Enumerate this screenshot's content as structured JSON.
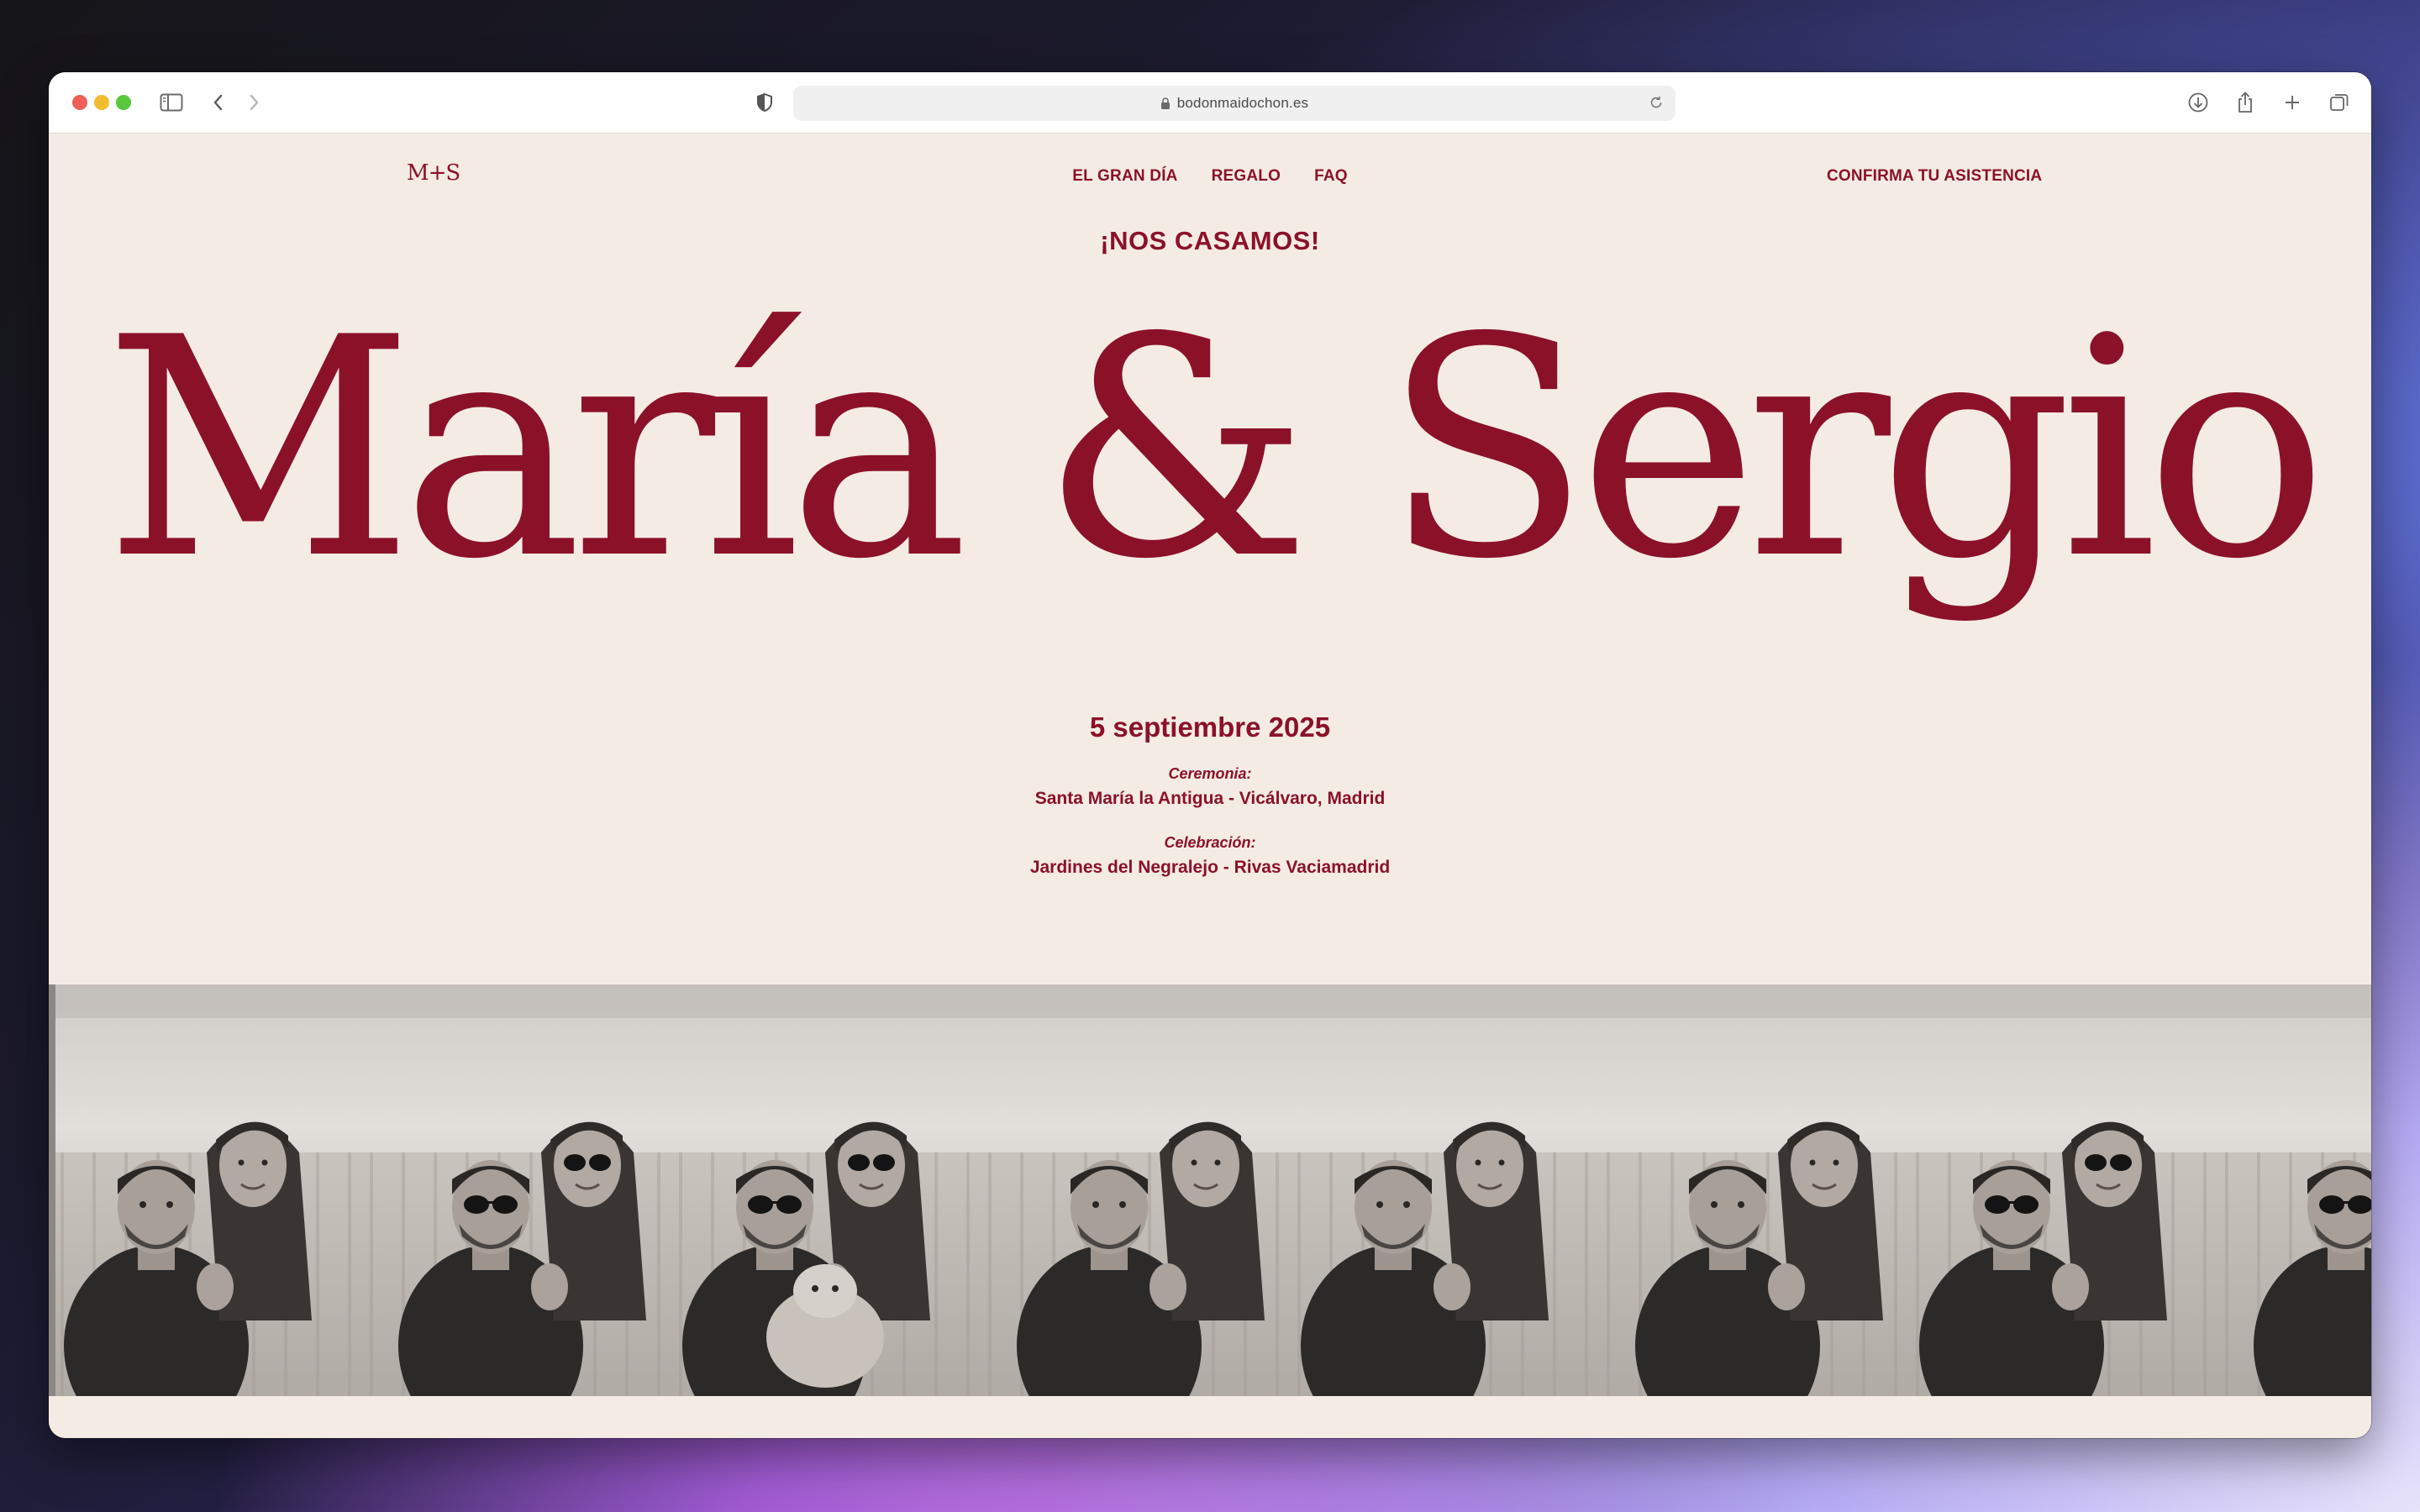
{
  "browser": {
    "url": "bodonmaidochon.es"
  },
  "site": {
    "logo": "M+S",
    "nav": [
      "EL GRAN DÍA",
      "REGALO",
      "FAQ"
    ],
    "rsvp": "CONFIRMA TU ASISTENCIA"
  },
  "hero": {
    "kicker": "¡NOS CASAMOS!",
    "names": "María & Sergio",
    "date": "5 septiembre 2025",
    "ceremony_label": "Ceremonia:",
    "ceremony_place": "Santa María la Antigua - Vicálvaro, Madrid",
    "celebration_label": "Celebración:",
    "celebration_place": "Jardines del Negralejo - Rivas Vaciamadrid"
  },
  "photos": [
    {
      "label": "couple-photo-1",
      "sunglasses": false
    },
    {
      "label": "couple-photo-2",
      "sunglasses": true
    },
    {
      "label": "couple-photo-3-dog",
      "sunglasses": true
    },
    {
      "label": "couple-photo-4",
      "sunglasses": false
    },
    {
      "label": "couple-photo-5",
      "sunglasses": false
    },
    {
      "label": "couple-photo-6",
      "sunglasses": false
    },
    {
      "label": "couple-photo-7",
      "sunglasses": true
    },
    {
      "label": "couple-photo-8",
      "sunglasses": true
    }
  ],
  "colors": {
    "accent": "#8b1129",
    "background": "#f4ebe4"
  }
}
